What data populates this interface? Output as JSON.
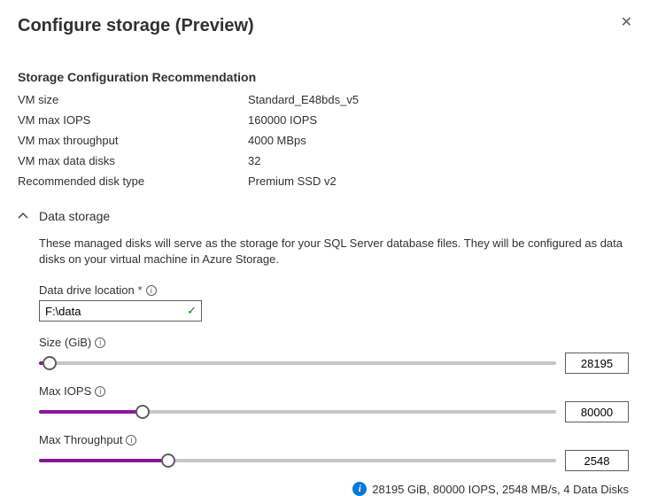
{
  "header": {
    "title": "Configure storage (Preview)"
  },
  "recommendation": {
    "heading": "Storage Configuration Recommendation",
    "rows": {
      "vm_size_label": "VM size",
      "vm_size_value": "Standard_E48bds_v5",
      "vm_max_iops_label": "VM max IOPS",
      "vm_max_iops_value": "160000 IOPS",
      "vm_max_throughput_label": "VM max throughput",
      "vm_max_throughput_value": "4000 MBps",
      "vm_max_disks_label": "VM max data disks",
      "vm_max_disks_value": "32",
      "rec_disk_type_label": "Recommended disk type",
      "rec_disk_type_value": "Premium SSD v2"
    }
  },
  "data_storage": {
    "section_label": "Data storage",
    "description": "These managed disks will serve as the storage for your SQL Server database files. They will be configured as data disks on your virtual machine in Azure Storage.",
    "drive_location_label": "Data drive location",
    "drive_location_value": "F:\\data",
    "size_label": "Size (GiB)",
    "size_value": "28195",
    "size_pct": 2,
    "iops_label": "Max IOPS",
    "iops_value": "80000",
    "iops_pct": 20,
    "throughput_label": "Max Throughput",
    "throughput_value": "2548",
    "throughput_pct": 25
  },
  "summary": {
    "text": "28195 GiB, 80000 IOPS, 2548 MB/s, 4 Data Disks"
  }
}
